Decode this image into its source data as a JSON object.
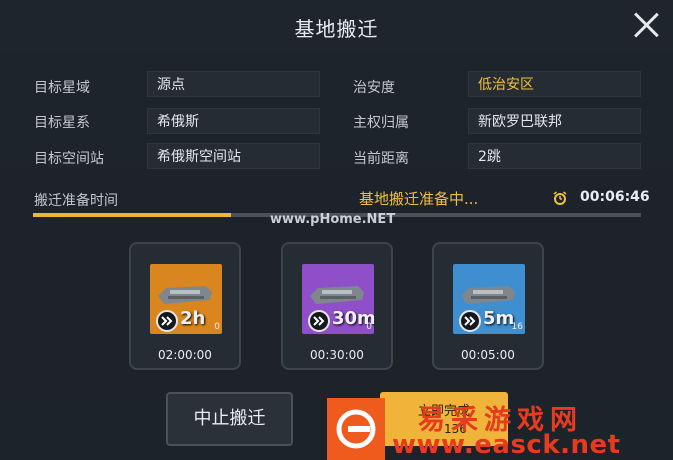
{
  "dialog": {
    "title": "基地搬迁"
  },
  "info": {
    "left": [
      {
        "label": "目标星域",
        "value": "源点"
      },
      {
        "label": "目标星系",
        "value": "希俄斯"
      },
      {
        "label": "目标空间站",
        "value": "希俄斯空间站"
      }
    ],
    "right": [
      {
        "label": "治安度",
        "value": "低治安区",
        "value_color": "#f0c040"
      },
      {
        "label": "主权归属",
        "value": "新欧罗巴联邦"
      },
      {
        "label": "当前距离",
        "value": "2跳"
      }
    ]
  },
  "prep": {
    "label": "搬迁准备时间",
    "status": "基地搬迁准备中...",
    "timer": "00:06:46",
    "progress": 0.325
  },
  "speedups": [
    {
      "text": "2h",
      "count": "0",
      "time": "02:00:00",
      "bg": "#d9861e",
      "icon": "ship-icon"
    },
    {
      "text": "30m",
      "count": "0",
      "time": "00:30:00",
      "bg": "#8f4fc9",
      "icon": "ship-icon"
    },
    {
      "text": "5m",
      "count": "16",
      "time": "00:05:00",
      "bg": "#3f8fd0",
      "icon": "ship-icon"
    }
  ],
  "buttons": {
    "stop": "中止搬迁",
    "complete": "立即完成",
    "cost": "136"
  },
  "watermark": {
    "site": "www.pHome.NET",
    "cn": "易采游戏网",
    "en": "www.easck.net"
  },
  "colors": {
    "accent": "#f0b43a",
    "gold_text": "#f0c040",
    "watermark_red": "#e63b1e"
  }
}
